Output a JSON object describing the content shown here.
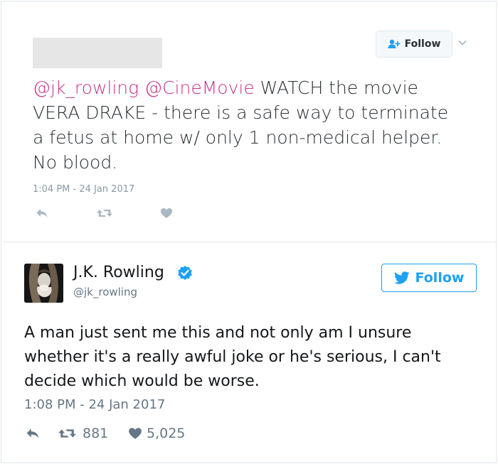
{
  "tweet1": {
    "follow_label": "Follow",
    "mentions": [
      "@jk_rowling",
      "@CineMovie"
    ],
    "text_line1_rest": " WATCH the movie",
    "text_line2": "VERA DRAKE - there is a safe way to terminate",
    "text_line3": "a fetus at home w/ only 1 non-medical helper.",
    "text_line4": "No blood.",
    "timestamp": "1:04 PM - 24 Jan 2017",
    "icons": [
      "reply-icon",
      "retweet-icon",
      "heart-icon",
      "add-user-icon",
      "chevron-down-icon"
    ]
  },
  "tweet2": {
    "display_name": "J.K. Rowling",
    "handle": "@jk_rowling",
    "follow_label": "Follow",
    "text": "A man just sent me this and not only am I unsure whether it's a really awful joke or he's serious, I can't decide which would be worse.",
    "timestamp": "1:08 PM - 24 Jan 2017",
    "retweets": "881",
    "likes": "5,025",
    "icons": [
      "reply-icon",
      "retweet-icon",
      "heart-icon",
      "twitter-bird-icon",
      "verified-badge-icon"
    ]
  },
  "colors": {
    "mention": "#c8338a",
    "twitter_blue": "#1da1f2",
    "muted": "#8899a6",
    "border": "#e1e8ed"
  }
}
